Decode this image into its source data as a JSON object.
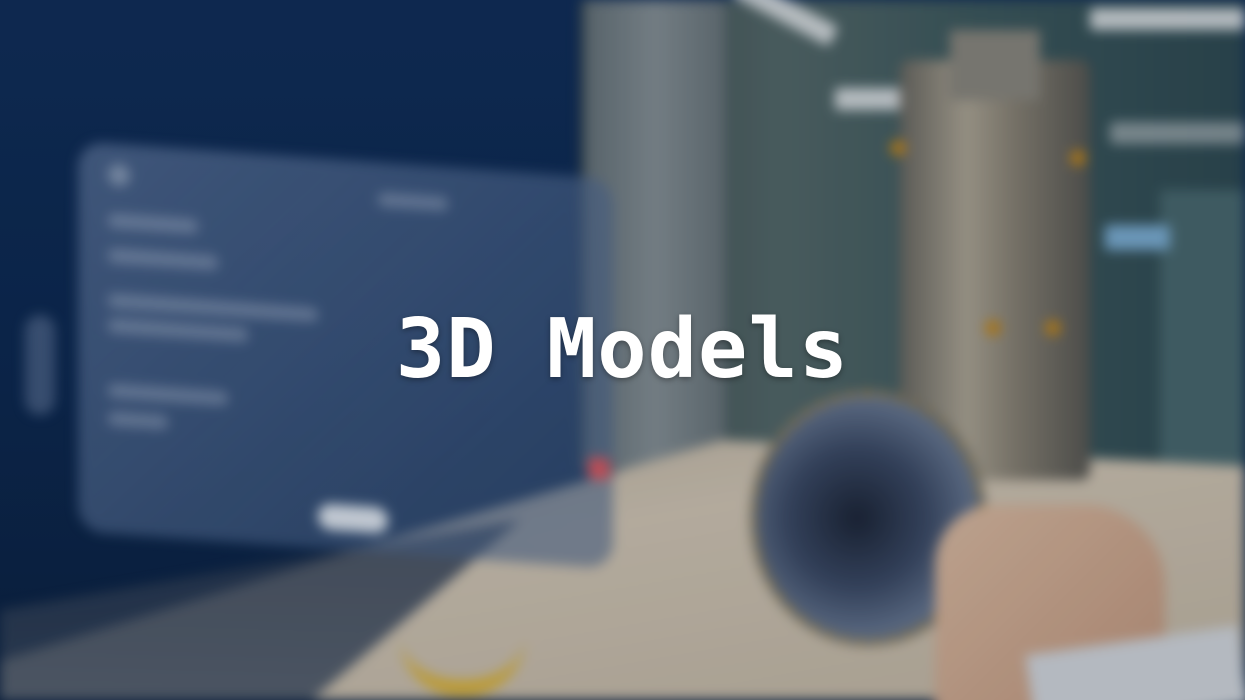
{
  "overlay": {
    "title": "3D Models"
  },
  "colors": {
    "title_text": "#ffffff",
    "background_wall": "#0f2d5a",
    "panel_accent_red": "#e05a63"
  },
  "scene": {
    "description_icons": [
      "floating-ui-panel",
      "3d-engine-model",
      "hand"
    ]
  }
}
